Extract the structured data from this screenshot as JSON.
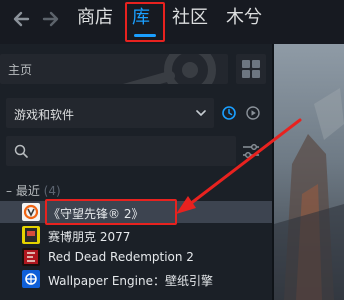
{
  "nav": {
    "store": "商店",
    "library": "库",
    "community": "社区",
    "user": "木兮"
  },
  "sidebar": {
    "home": "主页",
    "filter_label": "游戏和软件",
    "search_placeholder": "",
    "section": {
      "label": "最近",
      "count": "(4)"
    },
    "games": [
      {
        "name": "《守望先锋® 2》",
        "icon": "overwatch-icon",
        "selected": true
      },
      {
        "name": "赛博朋克 2077",
        "icon": "cyberpunk-icon",
        "selected": false
      },
      {
        "name": "Red Dead Redemption 2",
        "icon": "rdr2-icon",
        "selected": false
      },
      {
        "name": "Wallpaper Engine：壁纸引擎",
        "icon": "wallpaper-engine-icon",
        "selected": false
      }
    ]
  },
  "colors": {
    "accent": "#1a9fff",
    "annotation": "#e8221f",
    "background": "#171d25",
    "selected_row": "#3d4450"
  }
}
